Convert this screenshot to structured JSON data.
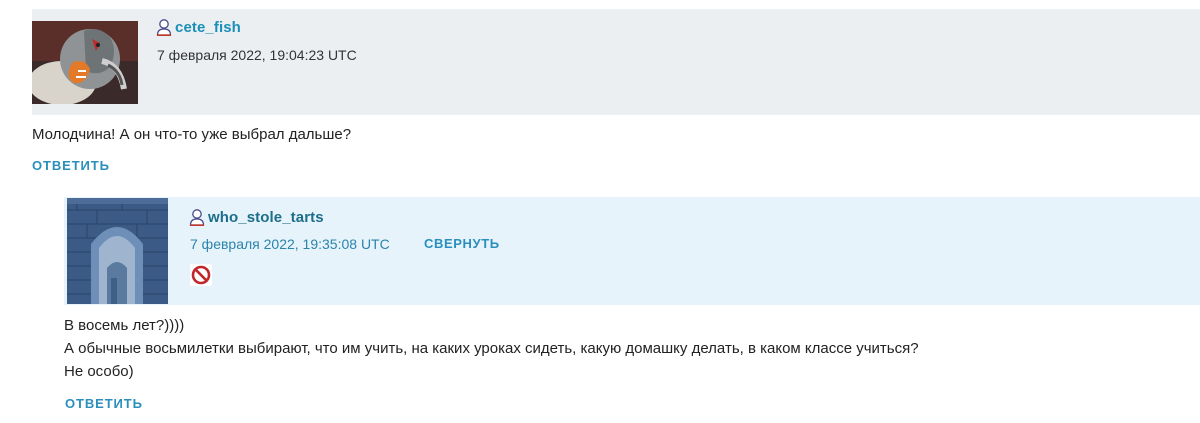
{
  "comments": [
    {
      "username": "cete_fish",
      "date": "7 февраля 2022, 19:04:23 UTC",
      "text_lines": [
        "Молодчина! А он что-то уже выбрал дальше?"
      ],
      "reply_label": "ОТВЕТИТЬ",
      "avatar": "cat-avatar",
      "user_icon": "user-icon"
    },
    {
      "username": "who_stole_tarts",
      "date": "7 февраля 2022, 19:35:08 UTC",
      "collapse_label": "СВЕРНУТЬ",
      "text_lines": [
        "В восемь лет?))))",
        "А обычные восьмилетки выбирают, что им учить, на каких уроках сидеть, какую домашку делать, в каком классе учиться?",
        "Не особо)"
      ],
      "reply_label": "ОТВЕТИТЬ",
      "avatar": "stone-arch-avatar",
      "user_icon": "user-icon",
      "status_icon": "ban-icon"
    }
  ],
  "colors": {
    "link": "#2a8fbd",
    "header_bg_1": "#eceff2",
    "header_bg_2": "#e7f3fb"
  }
}
